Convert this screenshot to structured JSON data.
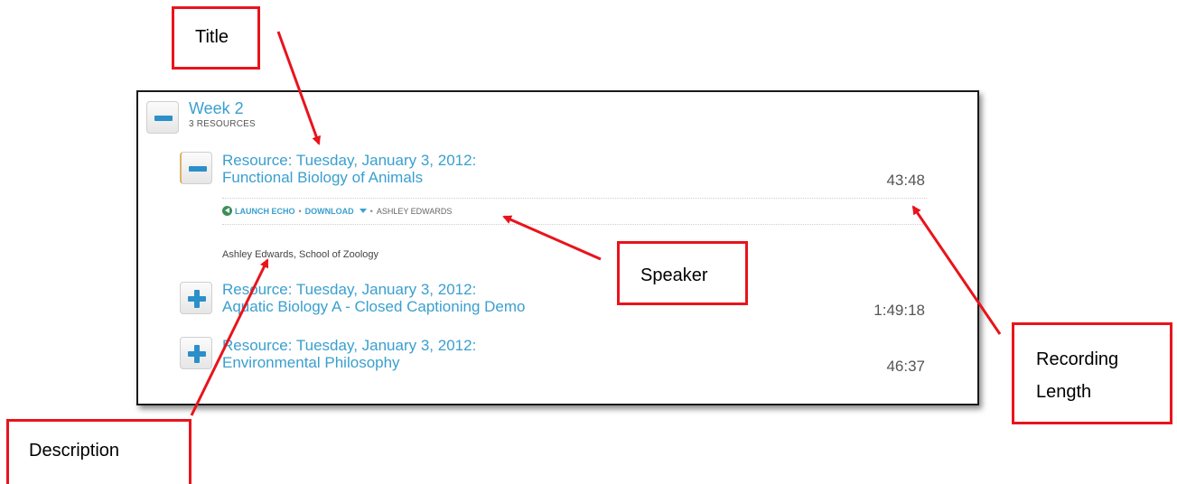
{
  "week": {
    "title": "Week 2",
    "count": "3 RESOURCES"
  },
  "resources": [
    {
      "title_line1": "Resource: Tuesday, January 3, 2012:",
      "title_line2": "Functional Biology of Animals",
      "duration": "43:48",
      "expanded": true,
      "actions": {
        "launch": "LAUNCH ECHO",
        "download": "DOWNLOAD",
        "speaker": "ASHLEY EDWARDS"
      },
      "description": "Ashley Edwards, School of Zoology"
    },
    {
      "title_line1": "Resource: Tuesday, January 3, 2012:",
      "title_line2": "Aquatic Biology A - Closed Captioning Demo",
      "duration": "1:49:18",
      "expanded": false
    },
    {
      "title_line1": "Resource: Tuesday, January 3, 2012:",
      "title_line2": "Environmental Philosophy",
      "duration": "46:37",
      "expanded": false
    }
  ],
  "annotations": {
    "title": "Title",
    "speaker": "Speaker",
    "recording_line1": "Recording",
    "recording_line2": "Length",
    "description": "Description"
  },
  "colors": {
    "link_blue": "#3a9fcf",
    "annotation_red": "#e8141c",
    "echo_green": "#3b8f5a"
  }
}
